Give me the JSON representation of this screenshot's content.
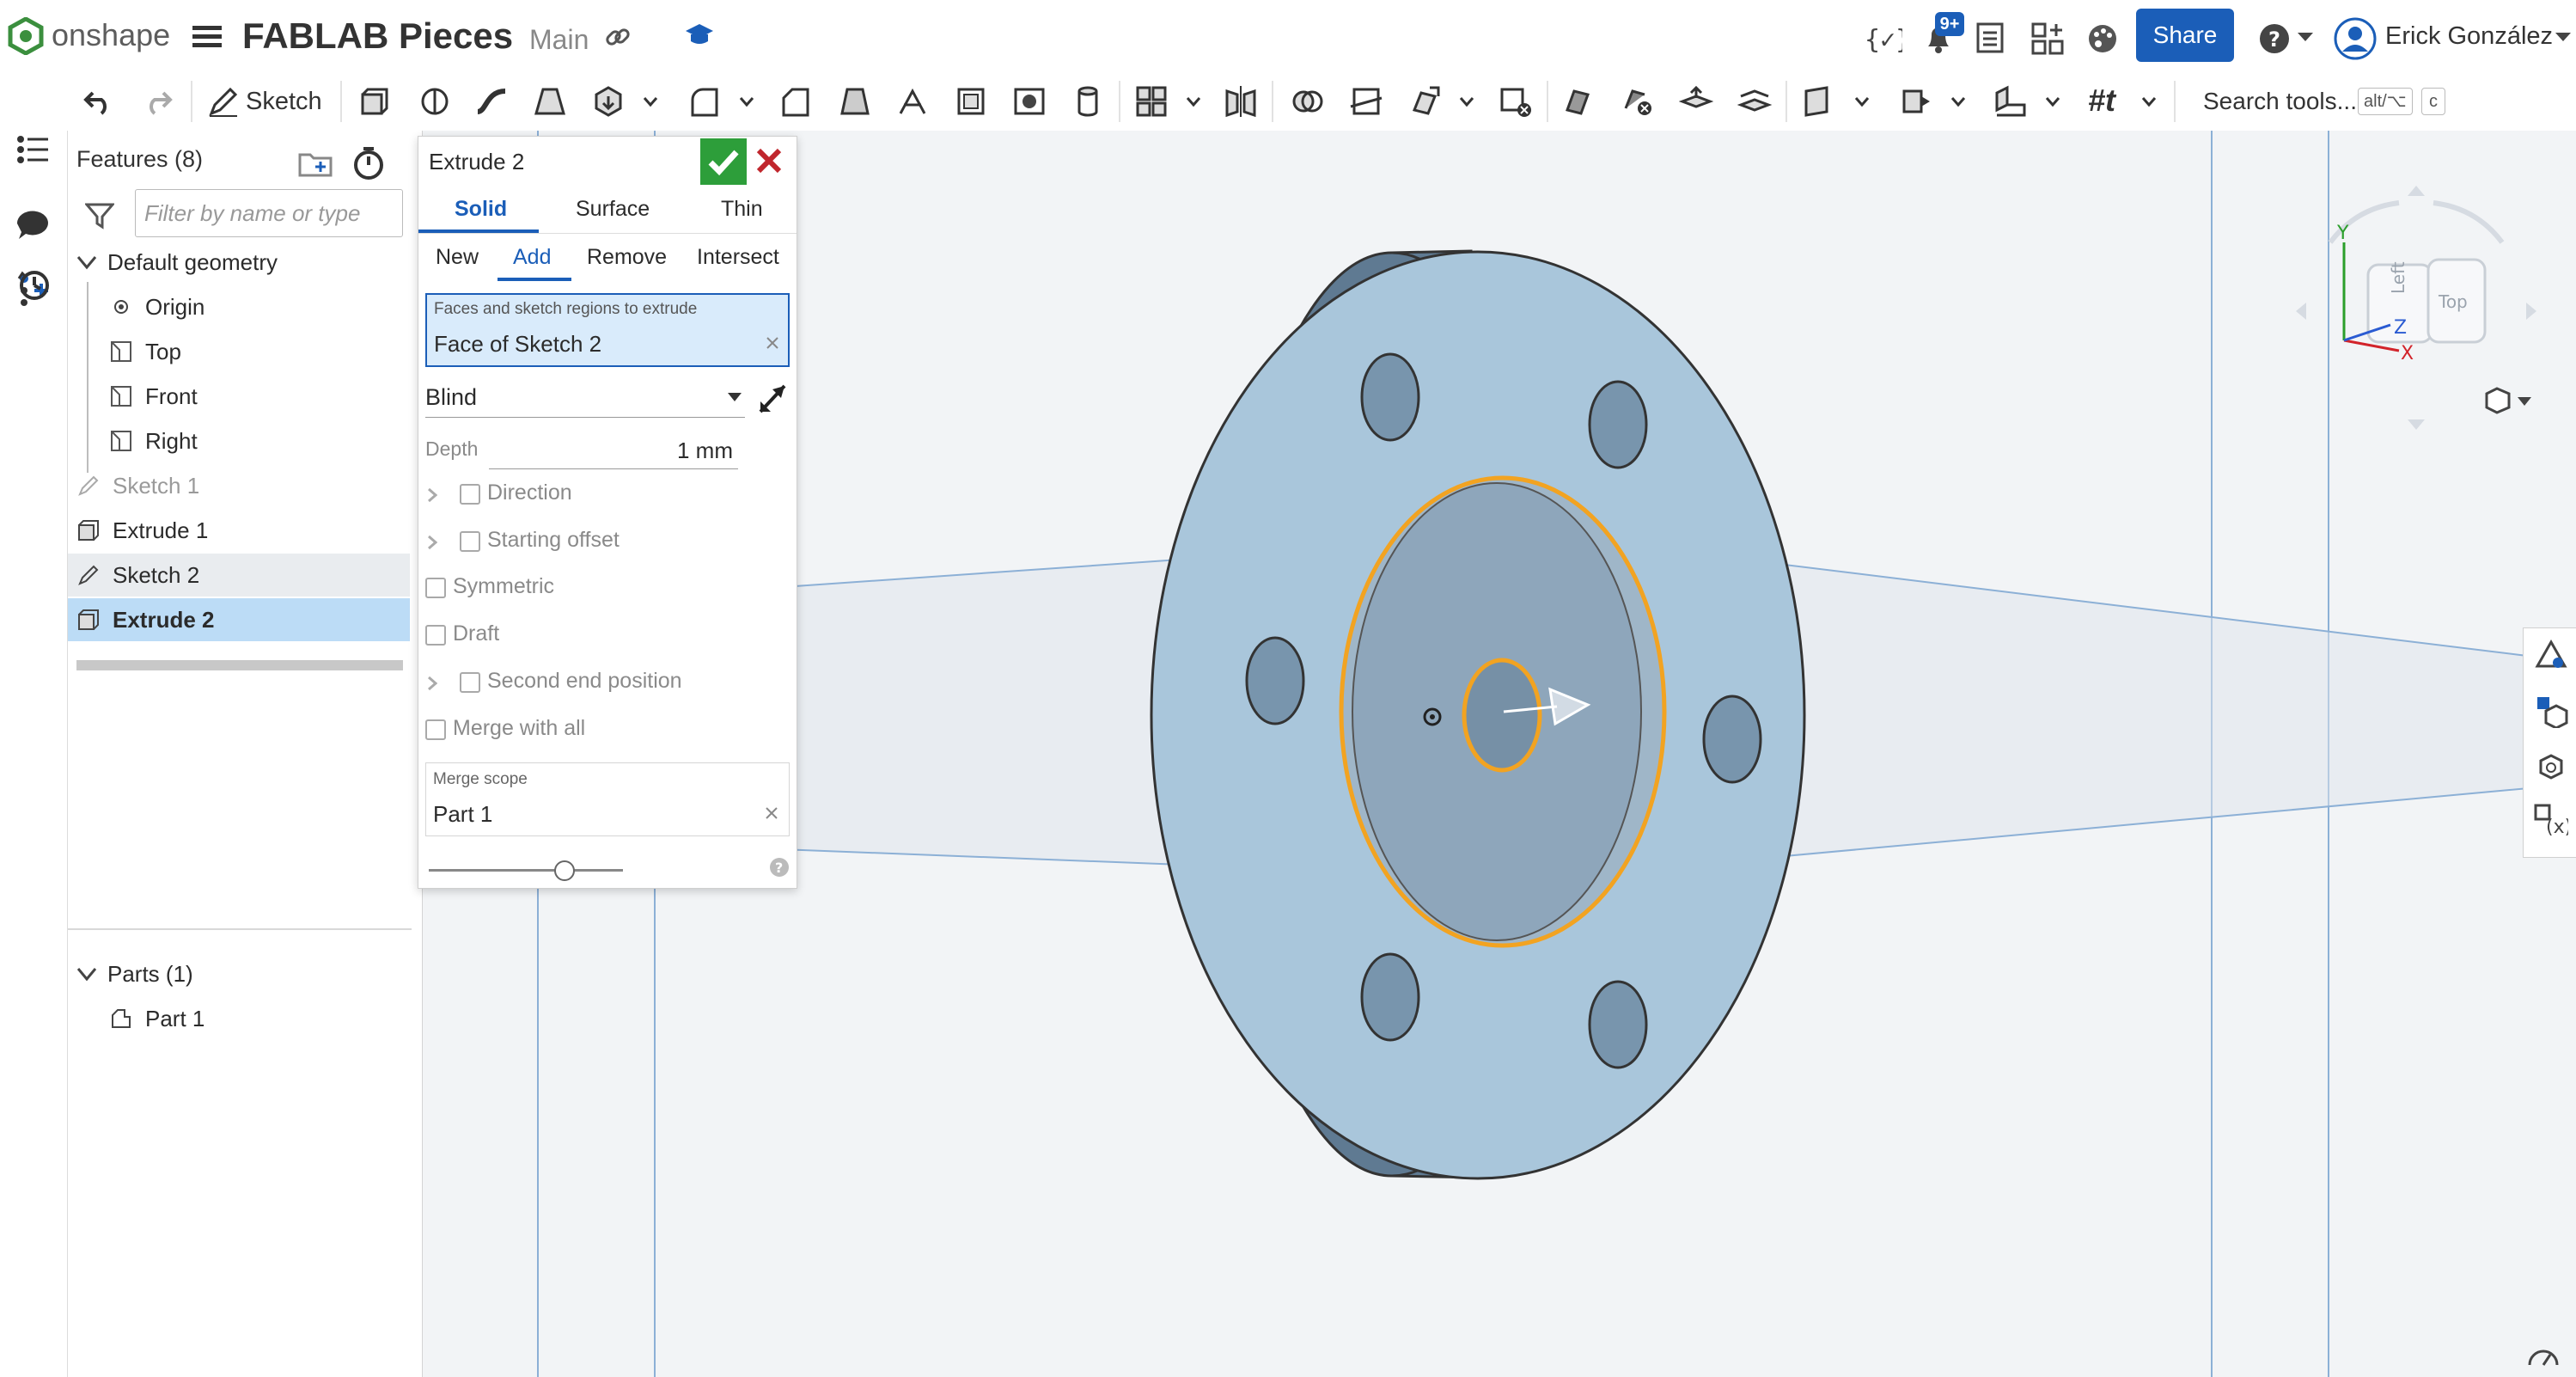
{
  "app": {
    "logo_text": "onshape",
    "doc_title": "FABLAB Pieces",
    "branch": "Main"
  },
  "header": {
    "notifications_badge": "9+",
    "share_label": "Share",
    "user_name": "Erick González",
    "brand_color": "#1b5eb8"
  },
  "toolbar": {
    "sketch_label": "Sketch",
    "search_label": "Search tools...",
    "search_shortcut_1": "alt/⌥",
    "search_shortcut_2": "c",
    "featurescript_label": "#t"
  },
  "features_panel": {
    "title": "Features (8)",
    "filter_placeholder": "Filter by name or type",
    "default_geometry": "Default geometry",
    "items": [
      {
        "label": "Origin",
        "icon": "origin-icon"
      },
      {
        "label": "Top",
        "icon": "plane-icon"
      },
      {
        "label": "Front",
        "icon": "plane-icon"
      },
      {
        "label": "Right",
        "icon": "plane-icon"
      },
      {
        "label": "Sketch 1",
        "icon": "sketch-icon"
      },
      {
        "label": "Extrude 1",
        "icon": "extrude-icon"
      },
      {
        "label": "Sketch 2",
        "icon": "sketch-icon"
      },
      {
        "label": "Extrude 2",
        "icon": "extrude-icon"
      }
    ],
    "parts_header": "Parts (1)",
    "parts": [
      {
        "label": "Part 1"
      }
    ]
  },
  "extrude_dialog": {
    "title": "Extrude 2",
    "type_tabs": [
      "Solid",
      "Surface",
      "Thin"
    ],
    "active_type": "Solid",
    "op_tabs": [
      "New",
      "Add",
      "Remove",
      "Intersect"
    ],
    "active_op": "Add",
    "faces_label": "Faces and sketch regions to extrude",
    "faces_value": "Face of Sketch 2",
    "end_type": "Blind",
    "depth_label": "Depth",
    "depth_value": "1 mm",
    "options": {
      "direction": "Direction",
      "starting_offset": "Starting offset",
      "symmetric": "Symmetric",
      "draft": "Draft",
      "second_end": "Second end position",
      "merge_all": "Merge with all"
    },
    "merge_scope_label": "Merge scope",
    "merge_scope_value": "Part 1",
    "accept_color": "#2d9e3a",
    "cancel_color": "#c0262d",
    "slider_fraction": 0.7
  },
  "view_cube": {
    "front_label": "Left",
    "top_label": "Top",
    "axis_y": "Y",
    "axis_z": "Z",
    "axis_x": "X"
  }
}
